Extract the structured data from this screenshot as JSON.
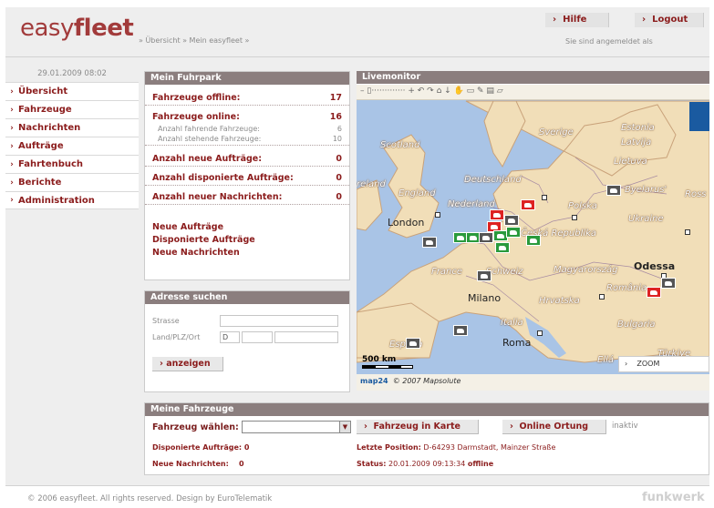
{
  "header": {
    "logo_light": "easy",
    "logo_bold": "fleet",
    "breadcrumb": "» Übersicht » Mein easyfleet »",
    "help_label": "Hilfe",
    "logout_label": "Logout",
    "logged_in_text": "Sie sind angemeldet als",
    "chevron": "›"
  },
  "sidebar": {
    "date": "29.01.2009 08:02",
    "items": [
      {
        "label": "Übersicht"
      },
      {
        "label": "Fahrzeuge"
      },
      {
        "label": "Nachrichten"
      },
      {
        "label": "Aufträge"
      },
      {
        "label": "Fahrtenbuch"
      },
      {
        "label": "Berichte"
      },
      {
        "label": "Administration"
      }
    ]
  },
  "fuhrpark": {
    "title": "Mein Fuhrpark",
    "offline_label": "Fahrzeuge offline:",
    "offline_value": "17",
    "online_label": "Fahrzeuge online:",
    "online_value": "16",
    "driving_label": "Anzahl fahrende Fahrzeuge:",
    "driving_value": "6",
    "standing_label": "Anzahl stehende Fahrzeuge:",
    "standing_value": "10",
    "new_orders_label": "Anzahl neue Aufträge:",
    "new_orders_value": "0",
    "dispatched_label": "Anzahl disponierte Aufträge:",
    "dispatched_value": "0",
    "new_messages_label": "Anzahl neuer Nachrichten:",
    "new_messages_value": "0",
    "links": [
      "Neue Aufträge",
      "Disponierte Aufträge",
      "Neue Nachrichten"
    ]
  },
  "address": {
    "title": "Adresse suchen",
    "street_label": "Strasse",
    "place_label": "Land/PLZ/Ort",
    "country_value": "D",
    "show_button": "anzeigen"
  },
  "livemonitor": {
    "title": "Livemonitor",
    "toolbar_text": "–  ▯·············  +  ↶  ↷  ⌂  ↓  ✋  ▭  ✎  ▤  ▱",
    "scale": "500 km",
    "copyright": "© 2007 Mapsolute",
    "map24": "map24",
    "zoom_label": "ZOOM",
    "labels": {
      "estonia": "Estonia",
      "sverige": "Sverige",
      "latvija": "Latvija",
      "lietuva": "Lietuva",
      "scotland": "Scotland",
      "ireland": "reland",
      "england": "England",
      "nederland": "Nederland",
      "deutschland": "Deutschland",
      "polska": "Polska",
      "byelarus": "Byelarus'",
      "ross": "Ross",
      "ukraine": "Ukraine",
      "london": "London",
      "ceska": "Česká Republika",
      "france": "France",
      "schweiz": "Schweiz",
      "magyar": "Magyarország",
      "odessa": "Odessa",
      "milano": "Milano",
      "hrvatska": "Hrvatska",
      "romania": "România",
      "italia": "Italia",
      "bulgaria": "Bulgaria",
      "espana": "España",
      "roma": "Roma",
      "ellada": "Ellá",
      "turkiye": "Türkiye"
    }
  },
  "vehicles": {
    "title": "Meine Fahrzeuge",
    "select_label": "Fahrzeug wählen:",
    "select_value": "",
    "map_button": "Fahrzeug in Karte",
    "locate_button": "Online Ortung",
    "status_inactive": "inaktiv",
    "dispatched_label": "Disponierte Aufträge:",
    "dispatched_value": "0",
    "messages_label": "Neue Nachrichten:",
    "messages_value": "0",
    "last_pos_label": "Letzte Position:",
    "last_pos_value": "D-64293 Darmstadt, Mainzer Straße",
    "status_label": "Status:",
    "status_value": "20.01.2009 09:13:34",
    "status_state": "offline"
  },
  "footer": {
    "copyright": "© 2006 easyfleet. All rights reserved. Design by EuroTelematik",
    "brand": "funkwerk"
  },
  "colors": {
    "accent": "#8b1c1c",
    "panel_header": "#8b7e7e",
    "map_land": "#f1deb8",
    "map_sea": "#a9c4e6"
  }
}
